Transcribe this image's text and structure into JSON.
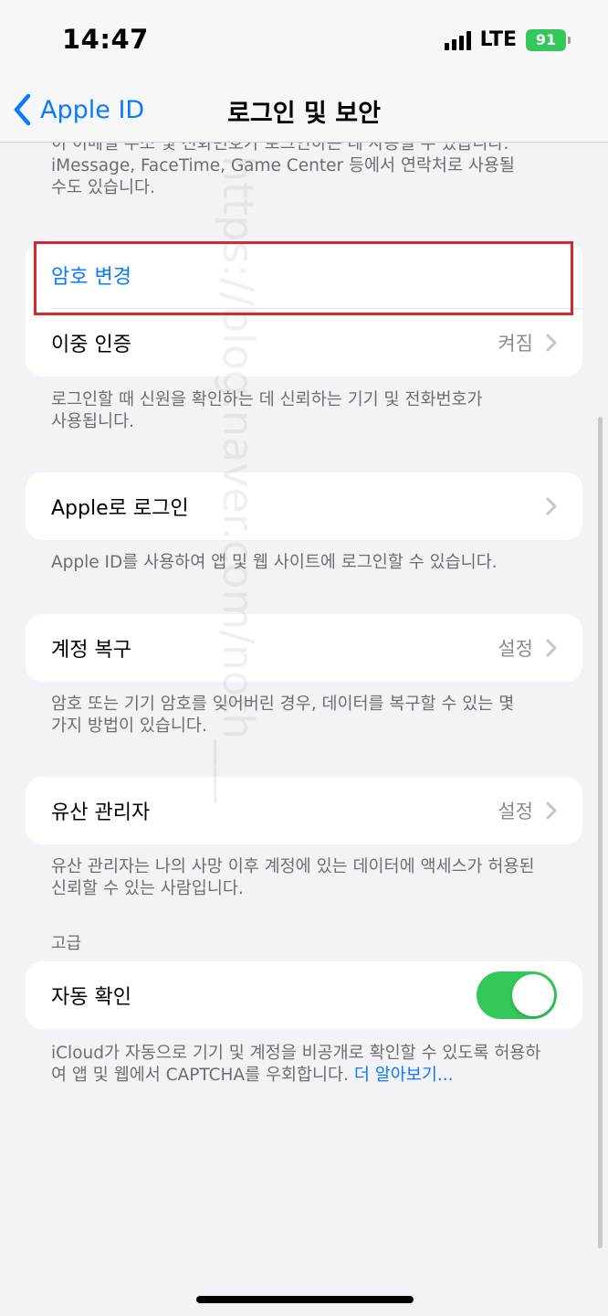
{
  "status_bar": {
    "time": "14:47",
    "network": "LTE",
    "battery": "91"
  },
  "nav": {
    "back_label": "Apple ID",
    "title": "로그인 및 보안"
  },
  "top_note": {
    "line1": "이 이메일 주소 및 전화번호가 로그인하는 데 사용될 수 있습니다.",
    "line2": "iMessage, FaceTime, Game Center 등에서 연락처로 사용될",
    "line3": "수도 있습니다."
  },
  "password_group": {
    "change_password": "암호 변경",
    "two_factor_label": "이중 인증",
    "two_factor_value": "켜짐",
    "footnote_line1": "로그인할 때 신원을 확인하는 데 신뢰하는 기기 및 전화번호가",
    "footnote_line2": "사용됩니다."
  },
  "sign_in_with_apple": {
    "label": "Apple로 로그인",
    "footnote": "Apple ID를 사용하여 앱 및 웹 사이트에 로그인할 수 있습니다."
  },
  "account_recovery": {
    "label": "계정 복구",
    "value": "설정",
    "footnote_line1": "암호 또는 기기 암호를 잊어버린 경우, 데이터를 복구할 수 있는 몇",
    "footnote_line2": "가지 방법이 있습니다."
  },
  "legacy_contact": {
    "label": "유산 관리자",
    "value": "설정",
    "footnote_line1": "유산 관리자는 나의 사망 이후 계정에 있는 데이터에 액세스가 허용된",
    "footnote_line2": "신뢰할 수 있는 사람입니다."
  },
  "advanced": {
    "header": "고급",
    "auto_verify_label": "자동 확인",
    "auto_verify_on": true,
    "footnote_line1": "iCloud가 자동으로 기기 및 계정을 비공개로 확인할 수 있도록 허용하",
    "footnote_line2": "여 앱 및 웹에서 CAPTCHA를 우회합니다.",
    "learn_more": "더 알아보기..."
  },
  "watermark": "https://blog.naver.com/noth___",
  "colors": {
    "accent": "#0a7aff",
    "toggle_on": "#34c759",
    "highlight": "#d6272b",
    "background": "#f2f2f7"
  }
}
